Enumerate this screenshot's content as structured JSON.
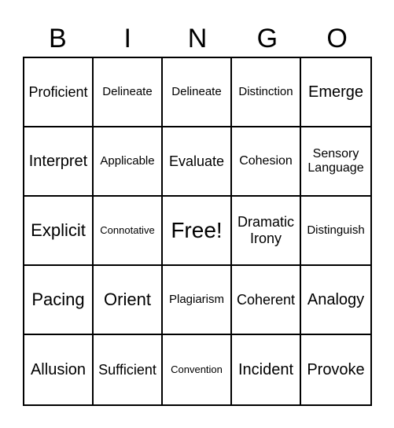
{
  "header": [
    "B",
    "I",
    "N",
    "G",
    "O"
  ],
  "rows": [
    [
      "Proficient",
      "Delineate",
      "Delineate",
      "Distinction",
      "Emerge"
    ],
    [
      "Interpret",
      "Applicable",
      "Evaluate",
      "Cohesion",
      "Sensory Language"
    ],
    [
      "Explicit",
      "Connotative",
      "Free!",
      "Dramatic Irony",
      "Distinguish"
    ],
    [
      "Pacing",
      "Orient",
      "Plagiarism",
      "Coherent",
      "Analogy"
    ],
    [
      "Allusion",
      "Sufficient",
      "Convention",
      "Incident",
      "Provoke"
    ]
  ]
}
